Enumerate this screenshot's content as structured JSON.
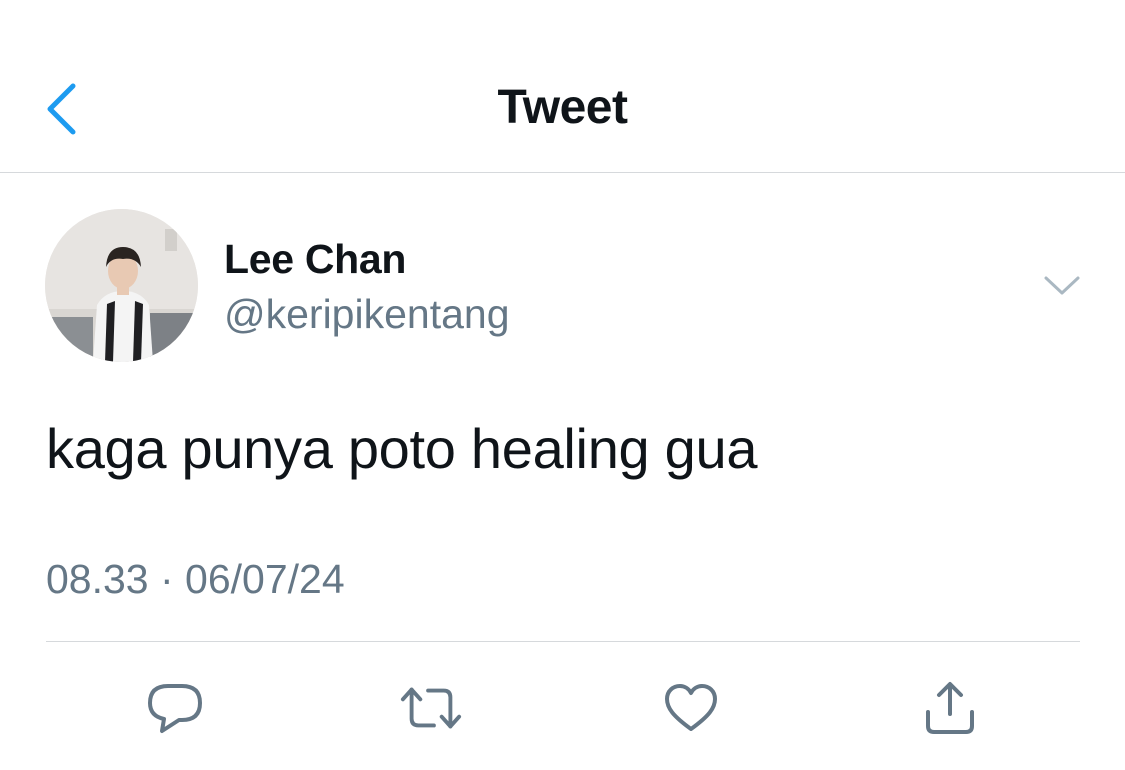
{
  "header": {
    "title": "Tweet",
    "back_icon": "chevron-left-icon"
  },
  "tweet": {
    "author": {
      "display_name": "Lee Chan",
      "handle": "@keripikentang"
    },
    "text": "kaga punya poto healing gua",
    "timestamp": "08.33 · 06/07/24",
    "more_icon": "chevron-down-icon"
  },
  "actions": {
    "icons": [
      "reply-icon",
      "retweet-icon",
      "like-icon",
      "share-icon"
    ]
  },
  "colors": {
    "accent": "#1d9bf0",
    "text_primary": "#0f1419",
    "text_secondary": "#657786",
    "divider": "#d6d9dc",
    "icon": "#657786"
  }
}
